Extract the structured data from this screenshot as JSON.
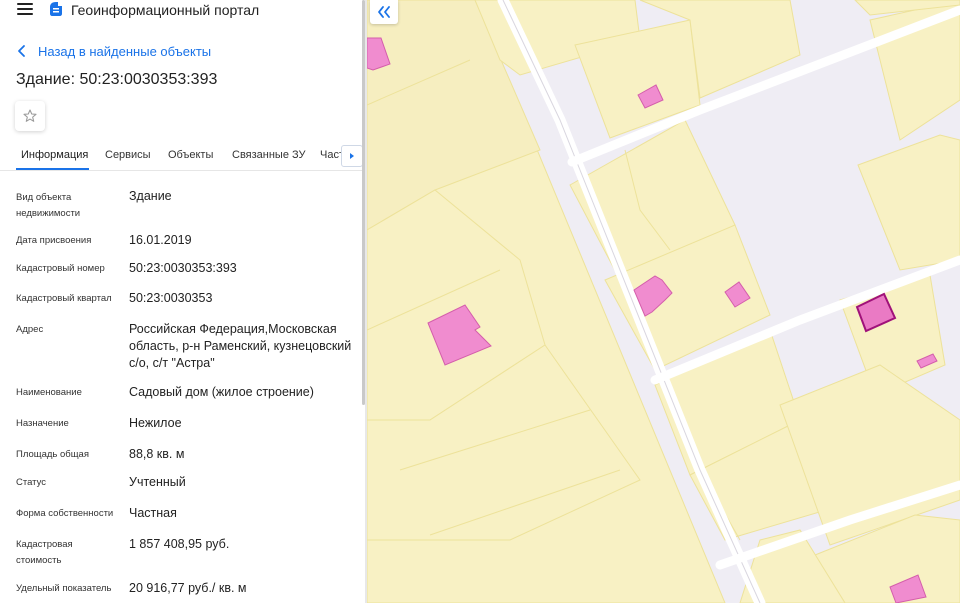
{
  "header": {
    "app_title": "Геоинформационный портал",
    "menu_icon": "hamburger-menu-icon",
    "logo_icon": "portal-logo-icon"
  },
  "navigation": {
    "back_label": "Назад в найденные объекты"
  },
  "object": {
    "title": "Здание: 50:23:0030353:393",
    "favorite_icon": "star-outline-icon"
  },
  "tabs": [
    {
      "label": "Информация",
      "active": true
    },
    {
      "label": "Сервисы",
      "active": false
    },
    {
      "label": "Объекты",
      "active": false
    },
    {
      "label": "Связанные ЗУ",
      "active": false
    },
    {
      "label": "Част",
      "active": false
    }
  ],
  "properties": [
    {
      "label": "Вид объекта недвижимости",
      "value": "Здание"
    },
    {
      "label": "Дата присвоения",
      "value": "16.01.2019"
    },
    {
      "label": "Кадастровый номер",
      "value": "50:23:0030353:393"
    },
    {
      "label": "Кадастровый квартал",
      "value": "50:23:0030353"
    },
    {
      "label": "Адрес",
      "value": "Российская Федерация,Московская область, р-н Раменский, кузнецовский с/о, с/т \"Астра\""
    },
    {
      "label": "Наименование",
      "value": "Садовый дом (жилое строение)"
    },
    {
      "label": "Назначение",
      "value": "Нежилое"
    },
    {
      "label": "Площадь общая",
      "value": "88,8 кв. м"
    },
    {
      "label": "Статус",
      "value": "Учтенный"
    },
    {
      "label": "Форма собственности",
      "value": "Частная"
    },
    {
      "label": "Кадастровая стоимость",
      "value": "1 857 408,95 руб."
    },
    {
      "label": "Удельный показатель",
      "value": "20 916,77 руб./ кв. м"
    }
  ],
  "map": {
    "collapse_icon": "double-chevron-left-icon",
    "colors": {
      "background": "#efedf4",
      "parcel_fill": "#f8f1c4",
      "parcel_stroke": "#ede29a",
      "road": "#ffffff",
      "building_fill": "#f08ccf",
      "building_stroke": "#d45eab",
      "selected_building_stroke": "#a0127a",
      "accent": "#1a73e8"
    }
  }
}
